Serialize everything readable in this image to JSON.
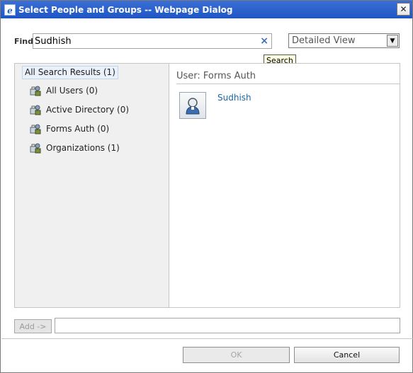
{
  "window": {
    "title": "Select People and Groups -- Webpage Dialog",
    "close_glyph": "✕"
  },
  "find": {
    "label": "Find",
    "value": "Sudhish",
    "clear_glyph": "×",
    "tooltip": "Search"
  },
  "view_select": {
    "selected": "Detailed View",
    "arrow_glyph": "▼"
  },
  "tree": {
    "root": "All Search Results (1)",
    "items": [
      {
        "label": "All Users (0)"
      },
      {
        "label": "Active Directory (0)"
      },
      {
        "label": "Forms Auth (0)"
      },
      {
        "label": "Organizations (1)"
      }
    ]
  },
  "results": {
    "header": "User: Forms Auth",
    "items": [
      {
        "name": "Sudhish"
      }
    ]
  },
  "footer": {
    "add_label": "Add ->",
    "ok_label": "OK",
    "cancel_label": "Cancel"
  },
  "colors": {
    "titlebar": "#1f56c4",
    "link": "#1a66a8",
    "left_pane_bg": "#f0f0f0"
  }
}
